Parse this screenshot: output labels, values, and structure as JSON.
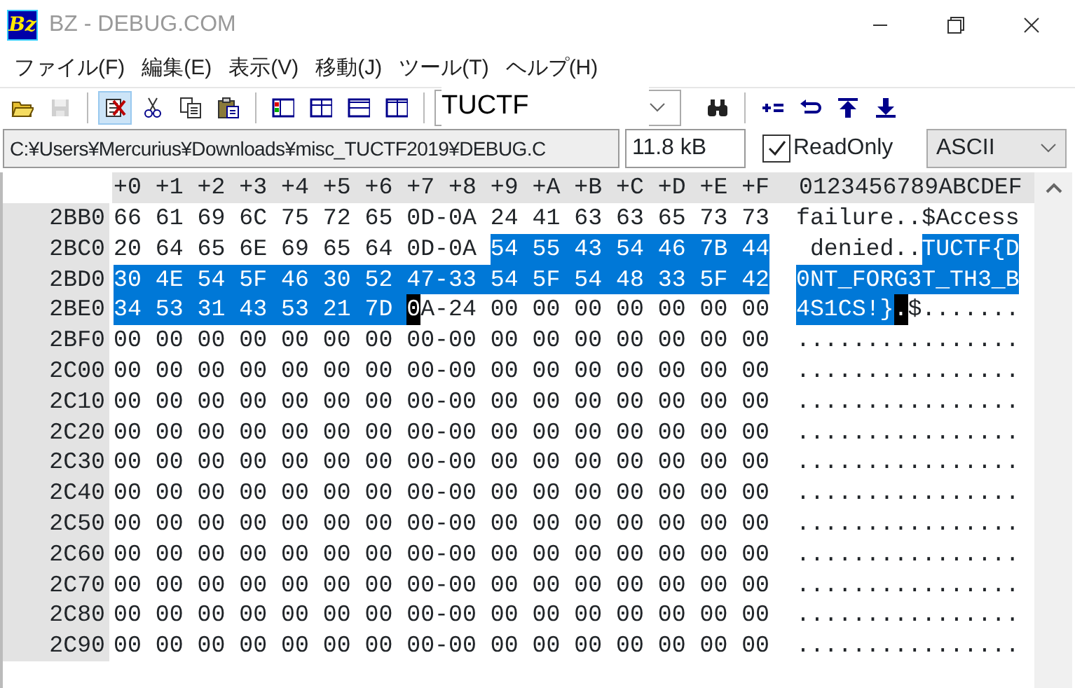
{
  "window": {
    "title": "BZ - DEBUG.COM",
    "logo": "Bz"
  },
  "menu": [
    {
      "label": "ファイル(F)"
    },
    {
      "label": "編集(E)"
    },
    {
      "label": "表示(V)"
    },
    {
      "label": "移動(J)"
    },
    {
      "label": "ツール(T)"
    },
    {
      "label": "ヘルプ(H)"
    }
  ],
  "toolbar": {
    "left": [
      [
        {
          "kind": "open",
          "disabled": false,
          "pressed": false
        },
        {
          "kind": "save",
          "disabled": true,
          "pressed": false
        }
      ],
      [
        {
          "kind": "edit",
          "disabled": false,
          "pressed": true
        },
        {
          "kind": "cut",
          "disabled": false,
          "pressed": false
        },
        {
          "kind": "copy",
          "disabled": false,
          "pressed": false
        },
        {
          "kind": "paste",
          "disabled": false,
          "pressed": false
        }
      ],
      [
        {
          "kind": "view1",
          "disabled": false,
          "pressed": false
        },
        {
          "kind": "view2",
          "disabled": false,
          "pressed": false
        },
        {
          "kind": "view3",
          "disabled": false,
          "pressed": false
        },
        {
          "kind": "view4",
          "disabled": false,
          "pressed": false
        }
      ]
    ],
    "search": {
      "value": "TUCTF"
    },
    "right": [
      [
        {
          "kind": "find",
          "disabled": false,
          "pressed": false
        }
      ],
      [
        {
          "kind": "compare",
          "disabled": false,
          "pressed": false
        },
        {
          "kind": "back",
          "disabled": false,
          "pressed": false
        },
        {
          "kind": "top",
          "disabled": false,
          "pressed": false
        },
        {
          "kind": "bottom",
          "disabled": false,
          "pressed": false
        }
      ]
    ]
  },
  "pathbar": {
    "path": "C:¥Users¥Mercurius¥Downloads¥misc_TUCTF2019¥DEBUG.C",
    "size": "11.8 kB",
    "readonly": {
      "label": "ReadOnly",
      "checked": true
    },
    "encoding": "ASCII"
  },
  "hex_view": {
    "header": {
      "offsets": "+0 +1 +2 +3 +4 +5 +6 +7 +8 +9 +A +B +C +D +E +F",
      "ascii": "0123456789ABCDEF"
    },
    "rows": [
      {
        "address": "2BB0",
        "hex": [
          {
            "text": "66 61 69 6C 75 72 65 0D-0A 24 41 63 63 65 73 73",
            "kind": "plain"
          }
        ],
        "ascii": [
          {
            "text": "failure..$Access",
            "kind": "plain"
          }
        ]
      },
      {
        "address": "2BC0",
        "hex": [
          {
            "text": "20 64 65 6E 69 65 64 0D-0A ",
            "kind": "plain"
          },
          {
            "text": "54 55 43 54 46 7B 44",
            "kind": "selected"
          }
        ],
        "ascii": [
          {
            "text": " denied..",
            "kind": "plain"
          },
          {
            "text": "TUCTF{D",
            "kind": "selected"
          }
        ]
      },
      {
        "address": "2BD0",
        "hex": [
          {
            "text": "30 4E 54 5F 46 30 52 47-33 54 5F 54 48 33 5F 42",
            "kind": "selected"
          }
        ],
        "ascii": [
          {
            "text": "0NT_FORG3T_TH3_B",
            "kind": "selected"
          }
        ]
      },
      {
        "address": "2BE0",
        "hex": [
          {
            "text": "34 53 31 43 53 21 7D ",
            "kind": "selected"
          },
          {
            "text": "0",
            "kind": "cursor"
          },
          {
            "text": "A-24 00 00 00 00 00 00 00",
            "kind": "plain"
          }
        ],
        "ascii": [
          {
            "text": "4S1CS!}",
            "kind": "selected"
          },
          {
            "text": ".",
            "kind": "cursor"
          },
          {
            "text": "$.......",
            "kind": "plain"
          }
        ]
      },
      {
        "address": "2BF0",
        "hex": [
          {
            "text": "00 00 00 00 00 00 00 00-00 00 00 00 00 00 00 00",
            "kind": "plain"
          }
        ],
        "ascii": [
          {
            "text": "................",
            "kind": "plain"
          }
        ]
      },
      {
        "address": "2C00",
        "hex": [
          {
            "text": "00 00 00 00 00 00 00 00-00 00 00 00 00 00 00 00",
            "kind": "plain"
          }
        ],
        "ascii": [
          {
            "text": "................",
            "kind": "plain"
          }
        ]
      },
      {
        "address": "2C10",
        "hex": [
          {
            "text": "00 00 00 00 00 00 00 00-00 00 00 00 00 00 00 00",
            "kind": "plain"
          }
        ],
        "ascii": [
          {
            "text": "................",
            "kind": "plain"
          }
        ]
      },
      {
        "address": "2C20",
        "hex": [
          {
            "text": "00 00 00 00 00 00 00 00-00 00 00 00 00 00 00 00",
            "kind": "plain"
          }
        ],
        "ascii": [
          {
            "text": "................",
            "kind": "plain"
          }
        ]
      },
      {
        "address": "2C30",
        "hex": [
          {
            "text": "00 00 00 00 00 00 00 00-00 00 00 00 00 00 00 00",
            "kind": "plain"
          }
        ],
        "ascii": [
          {
            "text": "................",
            "kind": "plain"
          }
        ]
      },
      {
        "address": "2C40",
        "hex": [
          {
            "text": "00 00 00 00 00 00 00 00-00 00 00 00 00 00 00 00",
            "kind": "plain"
          }
        ],
        "ascii": [
          {
            "text": "................",
            "kind": "plain"
          }
        ]
      },
      {
        "address": "2C50",
        "hex": [
          {
            "text": "00 00 00 00 00 00 00 00-00 00 00 00 00 00 00 00",
            "kind": "plain"
          }
        ],
        "ascii": [
          {
            "text": "................",
            "kind": "plain"
          }
        ]
      },
      {
        "address": "2C60",
        "hex": [
          {
            "text": "00 00 00 00 00 00 00 00-00 00 00 00 00 00 00 00",
            "kind": "plain"
          }
        ],
        "ascii": [
          {
            "text": "................",
            "kind": "plain"
          }
        ]
      },
      {
        "address": "2C70",
        "hex": [
          {
            "text": "00 00 00 00 00 00 00 00-00 00 00 00 00 00 00 00",
            "kind": "plain"
          }
        ],
        "ascii": [
          {
            "text": "................",
            "kind": "plain"
          }
        ]
      },
      {
        "address": "2C80",
        "hex": [
          {
            "text": "00 00 00 00 00 00 00 00-00 00 00 00 00 00 00 00",
            "kind": "plain"
          }
        ],
        "ascii": [
          {
            "text": "................",
            "kind": "plain"
          }
        ]
      },
      {
        "address": "2C90",
        "hex": [
          {
            "text": "00 00 00 00 00 00 00 00-00 00 00 00 00 00 00 00",
            "kind": "plain"
          }
        ],
        "ascii": [
          {
            "text": "................",
            "kind": "plain"
          }
        ]
      }
    ]
  }
}
